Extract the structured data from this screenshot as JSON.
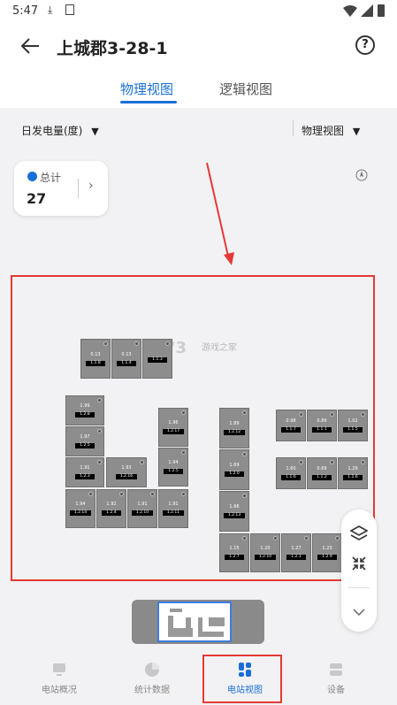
{
  "status_bar": {
    "time": "5:47"
  },
  "header": {
    "title": "上城郡3-28-1"
  },
  "tabs": [
    {
      "label": "物理视图",
      "active": true
    },
    {
      "label": "逻辑视图",
      "active": false
    }
  ],
  "filters": {
    "metric": "日发电量(度)",
    "view_mode": "物理视图"
  },
  "summary": {
    "label": "总计",
    "value": "27"
  },
  "panels": [
    {
      "value": "0.13",
      "id": "1.1.8"
    },
    {
      "value": "0.13",
      "id": "1.1.4"
    },
    {
      "value": "",
      "id": "1.1.3"
    },
    {
      "value": "1.99",
      "id": "1.2.8"
    },
    {
      "value": "1.97",
      "id": "1.2.5"
    },
    {
      "value": "1.91",
      "id": "1.2.3"
    },
    {
      "value": "1.93",
      "id": "1.2.16"
    },
    {
      "value": "1.94",
      "id": "1.2.14"
    },
    {
      "value": "1.92",
      "id": "1.2.4"
    },
    {
      "value": "1.91",
      "id": "1.2.10"
    },
    {
      "value": "1.91",
      "id": "1.2.11"
    },
    {
      "value": "1.96",
      "id": "1.2.17"
    },
    {
      "value": "1.94",
      "id": "1.2.5"
    },
    {
      "value": "1.89",
      "id": "1.2.12"
    },
    {
      "value": "1.69",
      "id": "1.2.0"
    },
    {
      "value": "1.66",
      "id": "1.2.13"
    },
    {
      "value": "0.98",
      "id": "1.1.7"
    },
    {
      "value": "0.89",
      "id": "1.1.1"
    },
    {
      "value": "1.02",
      "id": "1.1.5"
    },
    {
      "value": "1.60",
      "id": "1.1.6"
    },
    {
      "value": "0.69",
      "id": "1.1.2"
    },
    {
      "value": "1.29",
      "id": "1.1.6"
    },
    {
      "value": "1.15",
      "id": "1.2.7"
    },
    {
      "value": "1.20",
      "id": "1.2.10"
    },
    {
      "value": "1.27",
      "id": "1.2.1"
    },
    {
      "value": "1.23",
      "id": "1.2.9"
    }
  ],
  "bottom_nav": [
    {
      "label": "电站概况",
      "active": false
    },
    {
      "label": "统计数据",
      "active": false
    },
    {
      "label": "电站视图",
      "active": true
    },
    {
      "label": "设备",
      "active": false
    }
  ],
  "colors": {
    "accent": "#1a6fd6",
    "annotation": "#e53935"
  }
}
